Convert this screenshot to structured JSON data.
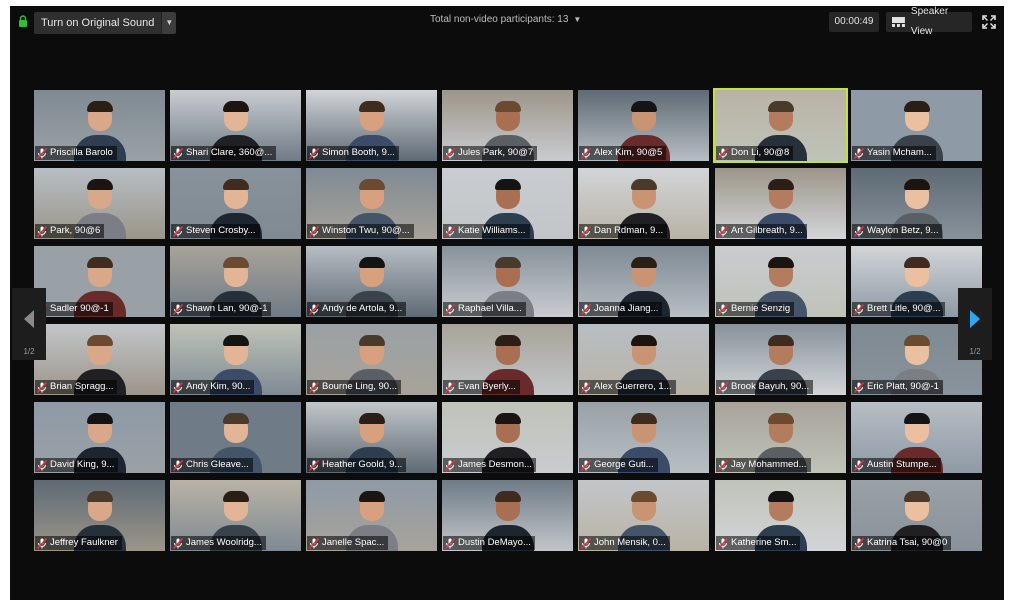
{
  "toolbar": {
    "original_sound_label": "Turn on Original Sound",
    "nonvideo_label": "Total non-video participants: 13",
    "timer": "00:00:49",
    "view_label": "Speaker View"
  },
  "pagination": {
    "left_page": "1/2",
    "right_page": "1/2"
  },
  "colors": {
    "active_speaker_border": "#c3e23a",
    "nav_arrow_right": "#2aa8f2",
    "mic_muted": "#e0333a"
  },
  "icons": [
    "lock-icon",
    "chevron-down-icon",
    "speaker-view-icon",
    "fullscreen-icon",
    "mic-muted-icon",
    "prev-page-icon",
    "next-page-icon"
  ],
  "participants": [
    {
      "name": "Priscilla Barolo",
      "active": false
    },
    {
      "name": "Shari Clare, 360@...",
      "active": false
    },
    {
      "name": "Simon Booth, 9...",
      "active": false
    },
    {
      "name": "Jules Park, 90@7",
      "active": false
    },
    {
      "name": "Alex Kim, 90@5",
      "active": false
    },
    {
      "name": "Don Li, 90@8",
      "active": true
    },
    {
      "name": "Yasin Mcham...",
      "active": false
    },
    {
      "name": "Park, 90@6",
      "active": false
    },
    {
      "name": "Steven Crosby...",
      "active": false
    },
    {
      "name": "Winston Twu, 90@...",
      "active": false
    },
    {
      "name": "Katie Williams...",
      "active": false
    },
    {
      "name": "Dan Rdman, 9...",
      "active": false
    },
    {
      "name": "Art Gilbreath, 9...",
      "active": false
    },
    {
      "name": "Waylon Betz, 9...",
      "active": false
    },
    {
      "name": "Sadler 90@-1",
      "active": false
    },
    {
      "name": "Shawn Lan, 90@-1",
      "active": false
    },
    {
      "name": "Andy de Artola, 9...",
      "active": false
    },
    {
      "name": "Raphael Villa...",
      "active": false
    },
    {
      "name": "Joanna Jiang...",
      "active": false
    },
    {
      "name": "Bernie Senzig",
      "active": false
    },
    {
      "name": "Brett Litle, 90@...",
      "active": false
    },
    {
      "name": "Brian Spragg...",
      "active": false
    },
    {
      "name": "Andy Kim, 90...",
      "active": false
    },
    {
      "name": "Bourne Ling, 90...",
      "active": false
    },
    {
      "name": "Evan Byerly...",
      "active": false
    },
    {
      "name": "Alex Guerrero, 1...",
      "active": false
    },
    {
      "name": "Brook Bayuh, 90...",
      "active": false
    },
    {
      "name": "Eric Platt, 90@-1",
      "active": false
    },
    {
      "name": "David King, 9...",
      "active": false
    },
    {
      "name": "Chris Gleave...",
      "active": false
    },
    {
      "name": "Heather Goold, 9...",
      "active": false
    },
    {
      "name": "James Desmon...",
      "active": false
    },
    {
      "name": "George Guti...",
      "active": false
    },
    {
      "name": "Jay Mohammed...",
      "active": false
    },
    {
      "name": "Austin Stumpe...",
      "active": false
    },
    {
      "name": "Jeffrey Faulkner",
      "active": false
    },
    {
      "name": "James Woolridg...",
      "active": false
    },
    {
      "name": "Janelle Spac...",
      "active": false
    },
    {
      "name": "Dustin DeMayo...",
      "active": false
    },
    {
      "name": "John Mensik, 0...",
      "active": false
    },
    {
      "name": "Katherine Sm...",
      "active": false
    },
    {
      "name": "Katrina Tsai, 90@0",
      "active": false
    }
  ]
}
